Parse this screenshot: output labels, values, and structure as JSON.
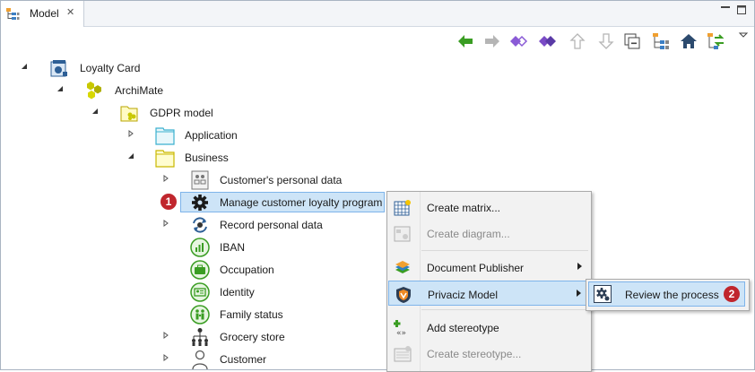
{
  "tab": {
    "title": "Model",
    "icon": "model-tree-icon",
    "close_icon": "close-icon"
  },
  "window_controls": [
    "minimize-icon",
    "maximize-icon"
  ],
  "toolbar": [
    "back-arrow-icon",
    "forward-arrow-icon",
    "link-diamond-icon",
    "link-diamond-filled-icon",
    "up-arrow-icon",
    "down-arrow-icon",
    "collapse-all-icon",
    "hierarchy-icon",
    "home-icon",
    "sync-icon",
    "view-menu-icon"
  ],
  "tree": [
    {
      "label": "Loyalty Card",
      "icon": "project-icon",
      "twisty": "expanded"
    },
    {
      "label": "ArchiMate",
      "icon": "archimate-icon",
      "twisty": "expanded"
    },
    {
      "label": "GDPR model",
      "icon": "model-folder-icon",
      "twisty": "expanded"
    },
    {
      "label": "Application",
      "icon": "folder-cyan-icon",
      "twisty": "collapsed"
    },
    {
      "label": "Business",
      "icon": "folder-yellow-icon",
      "twisty": "expanded"
    },
    {
      "label": "Customer's personal data",
      "icon": "data-object-icon",
      "twisty": "collapsed"
    },
    {
      "label": "Manage customer loyalty program",
      "icon": "gear-icon",
      "twisty": "none",
      "selected": true,
      "badge": "1"
    },
    {
      "label": "Record personal data",
      "icon": "process-cycle-icon",
      "twisty": "collapsed"
    },
    {
      "label": "IBAN",
      "icon": "iban-icon",
      "twisty": "none"
    },
    {
      "label": "Occupation",
      "icon": "briefcase-icon",
      "twisty": "none"
    },
    {
      "label": "Identity",
      "icon": "id-card-icon",
      "twisty": "none"
    },
    {
      "label": "Family status",
      "icon": "family-icon",
      "twisty": "none"
    },
    {
      "label": "Grocery store",
      "icon": "org-chart-icon",
      "twisty": "collapsed"
    },
    {
      "label": "Customer",
      "icon": "person-icon",
      "twisty": "collapsed"
    }
  ],
  "context_menu": [
    {
      "label": "Create matrix...",
      "icon": "matrix-icon",
      "enabled": true,
      "submenu": false
    },
    {
      "label": "Create diagram...",
      "icon": "diagram-icon",
      "enabled": false,
      "submenu": false
    },
    {
      "label": "Document Publisher",
      "icon": "book-stack-icon",
      "enabled": true,
      "submenu": true
    },
    {
      "label": "Privaciz Model",
      "icon": "privaciz-shield-icon",
      "enabled": true,
      "submenu": true,
      "highlighted": true
    },
    {
      "label": "Add stereotype",
      "icon": "add-stereotype-icon",
      "enabled": true,
      "submenu": false
    },
    {
      "label": "Create stereotype...",
      "icon": "create-stereotype-icon",
      "enabled": false,
      "submenu": false
    }
  ],
  "submenu": {
    "label": "Review the process",
    "icon": "review-gear-icon",
    "badge": "2"
  },
  "colors": {
    "selection": "#cde4f7",
    "selection_border": "#7eb4ea",
    "badge": "#c0262d",
    "accent_green": "#3a9d23"
  }
}
